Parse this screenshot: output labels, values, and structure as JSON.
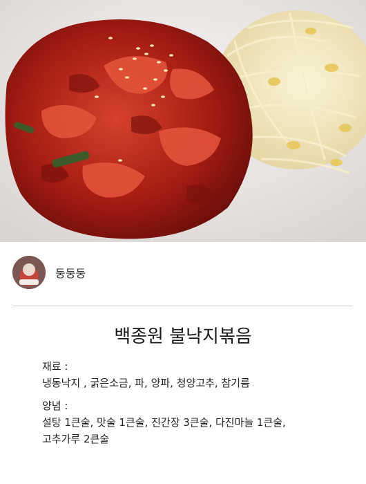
{
  "author": {
    "name": "둥둥둥"
  },
  "recipe": {
    "title": "백종원 불낙지볶음",
    "ingredients_label": "재료 :",
    "ingredients": "냉동낙지 , 굵은소금, 파, 양파, 청양고추, 참기름",
    "sauce_label": "양념 :",
    "sauce_line1": "설탕 1큰술, 맛술 1큰술, 진간장 3큰술, 다진마늘 1큰술,",
    "sauce_line2": "고추가루  2큰술"
  },
  "colors": {
    "sauce_red": "#b8231a",
    "sprouts": "#f1e6b8",
    "plate": "#ece9e8",
    "divider": "#c9c9c9"
  }
}
